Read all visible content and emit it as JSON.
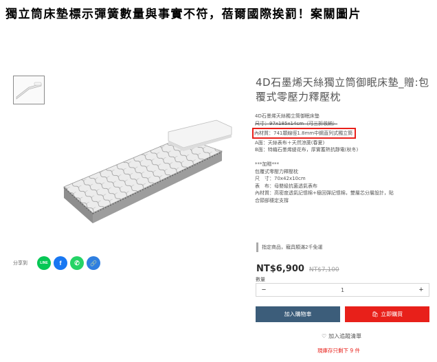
{
  "headline": "獨立筒床墊標示彈簧數量與事實不符，蓓爾國際挨罰！案關圖片",
  "share": {
    "label": "分享到",
    "buttons": [
      {
        "name": "line",
        "glyph": "LINE",
        "color": "#06c755"
      },
      {
        "name": "facebook",
        "glyph": "f",
        "color": "#1877f2"
      },
      {
        "name": "whatsapp",
        "glyph": "✆",
        "color": "#25d366"
      },
      {
        "name": "copy-link",
        "glyph": "🔗",
        "color": "#2f7fe0"
      }
    ]
  },
  "product": {
    "title": "4D石墨烯天絲獨立筒御眠床墊_贈:包覆式零壓力釋壓枕",
    "desc": [
      "4D石墨烯天絲獨立筒御眠床墊",
      "尺寸：97x185x14cm（可三折收納）",
      "內材質：741顆線徑1.8mm中鋼直列式獨立筒",
      "A面：天絲表布＋天然涼蓆(春夏)",
      "B面：特織石墨烯緹花布，厚實蓄熱抗靜電(秋冬)",
      "",
      "***加贈***",
      "包覆式零壓力釋壓枕",
      "尺　寸：70x42x10cm",
      "表　布：母嬰級抗菌透氣表布",
      "內材質：高密度透氣記憶棉+極回彈記憶棉，雙層芯分層設計，貼",
      "合頸部穩定支撐"
    ],
    "promo": "指定商品，寵具類滿2千免運",
    "price_now": "NT$6,900",
    "price_old": "NT$7,100",
    "qty_label": "數量",
    "qty_minus": "−",
    "qty_value": "1",
    "qty_plus": "+",
    "add_to_cart": "加入購物車",
    "buy_now": "立即購買",
    "buy_icon": "🛍",
    "wishlist_icon": "♡",
    "wishlist": "加入追蹤清單",
    "stock": "現庫存只剩下 9 件"
  }
}
